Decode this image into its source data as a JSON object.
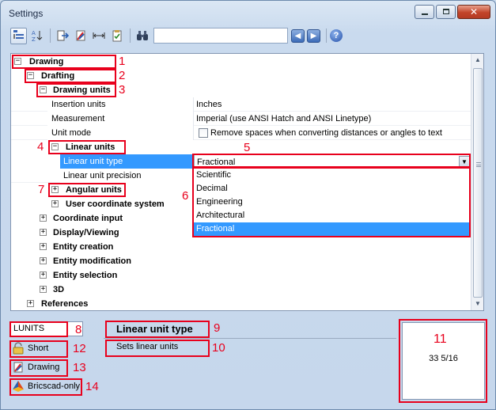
{
  "window": {
    "title": "Settings"
  },
  "toolbar": {
    "search_value": ""
  },
  "tree": {
    "drawing": "Drawing",
    "drafting": "Drafting",
    "drawing_units": "Drawing units",
    "props": [
      {
        "label": "Insertion units",
        "value": "Inches"
      },
      {
        "label": "Measurement",
        "value": "Imperial (use ANSI Hatch and ANSI Linetype)"
      }
    ],
    "unit_mode": {
      "label": "Unit mode",
      "value": "Remove spaces when converting distances or angles to text"
    },
    "linear_units": "Linear units",
    "linear_unit_type": {
      "label": "Linear unit type",
      "value": "Fractional"
    },
    "linear_unit_precision": {
      "label": "Linear unit precision"
    },
    "angular_units": "Angular units",
    "user_coordinate_system": "User coordinate system",
    "more_nodes": [
      "Coordinate input",
      "Display/Viewing",
      "Entity creation",
      "Entity modification",
      "Entity selection",
      "3D"
    ],
    "references": "References"
  },
  "dropdown": {
    "options": [
      "Scientific",
      "Decimal",
      "Engineering",
      "Architectural",
      "Fractional"
    ],
    "selected": "Fractional"
  },
  "bottom": {
    "command": "LUNITS",
    "setting_title": "Linear unit type",
    "setting_desc": "Sets linear units",
    "flags": {
      "short": "Short",
      "drawing": "Drawing",
      "bricscad": "Bricscad-only"
    },
    "preview_value": "33 5/16"
  },
  "callouts": [
    "1",
    "2",
    "3",
    "4",
    "5",
    "6",
    "7",
    "8",
    "9",
    "10",
    "11",
    "12",
    "13",
    "14"
  ],
  "colors": {
    "highlight": "#e8001c",
    "selection": "#3399ff"
  }
}
